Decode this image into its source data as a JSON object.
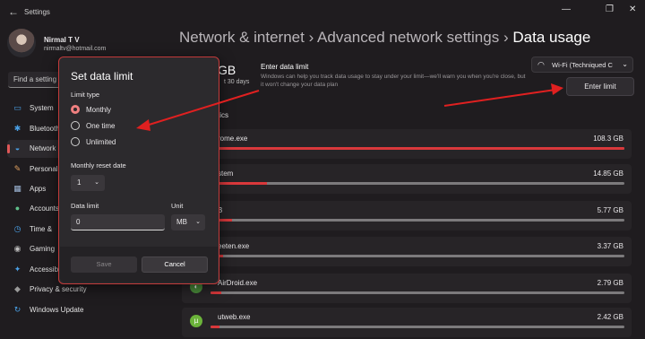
{
  "window": {
    "title": "Settings",
    "back_glyph": "←",
    "min_glyph": "—",
    "max_glyph": "❐",
    "close_glyph": "✕"
  },
  "profile": {
    "name": "Nirmal T V",
    "email": "nirmaltv@hotmail.com"
  },
  "search": {
    "placeholder": "Find a setting"
  },
  "nav": [
    {
      "label": "System",
      "icon": "monitor-icon"
    },
    {
      "label": "Bluetooth",
      "icon": "bluetooth-icon"
    },
    {
      "label": "Network",
      "icon": "wifi-icon",
      "active": true
    },
    {
      "label": "Personal",
      "icon": "brush-icon"
    },
    {
      "label": "Apps",
      "icon": "apps-icon"
    },
    {
      "label": "Accounts",
      "icon": "person-icon"
    },
    {
      "label": "Time &",
      "icon": "clock-icon"
    },
    {
      "label": "Gaming",
      "icon": "gamepad-icon"
    },
    {
      "label": "Accessib",
      "icon": "accessibility-icon"
    },
    {
      "label": "Privacy & security",
      "icon": "shield-icon"
    },
    {
      "label": "Windows Update",
      "icon": "update-icon"
    }
  ],
  "breadcrumb": {
    "part1": "Network & internet",
    "sep1": "›",
    "part2": "Advanced network settings",
    "sep2": "›",
    "current": "Data usage"
  },
  "usage": {
    "amount": "GB",
    "period": "t 30 days"
  },
  "enter_limit": {
    "title": "Enter data limit",
    "description": "Windows can help you track data usage to stay under your limit—we'll warn you when you're close, but it won't change your data plan",
    "button": "Enter limit"
  },
  "network_select": {
    "value": "Wi-Fi (Techniqued C",
    "chevron": "⌄"
  },
  "stats_label": "tics",
  "apps": [
    {
      "name": "rome.exe",
      "usage": "108.3 GB",
      "fraction": 1.0
    },
    {
      "name": "stem",
      "usage": "14.85 GB",
      "fraction": 0.137
    },
    {
      "name": "B",
      "usage": "5.77 GB",
      "fraction": 0.053
    },
    {
      "name": "eeten.exe",
      "usage": "3.37 GB",
      "fraction": 0.031
    },
    {
      "name": "AirDroid.exe",
      "usage": "2.79 GB",
      "fraction": 0.026
    },
    {
      "name": "utweb.exe",
      "usage": "2.42 GB",
      "fraction": 0.022
    }
  ],
  "dialog": {
    "title": "Set data limit",
    "limit_type_label": "Limit type",
    "options": [
      {
        "label": "Monthly",
        "selected": true
      },
      {
        "label": "One time",
        "selected": false
      },
      {
        "label": "Unlimited",
        "selected": false
      }
    ],
    "reset_date_label": "Monthly reset date",
    "reset_date_value": "1",
    "data_limit_label": "Data limit",
    "data_limit_value": "0",
    "unit_label": "Unit",
    "unit_value": "MB",
    "save_label": "Save",
    "cancel_label": "Cancel"
  },
  "colors": {
    "accent": "#d9383b",
    "annotation_arrow": "#e02020",
    "background": "#1f1c1f"
  }
}
